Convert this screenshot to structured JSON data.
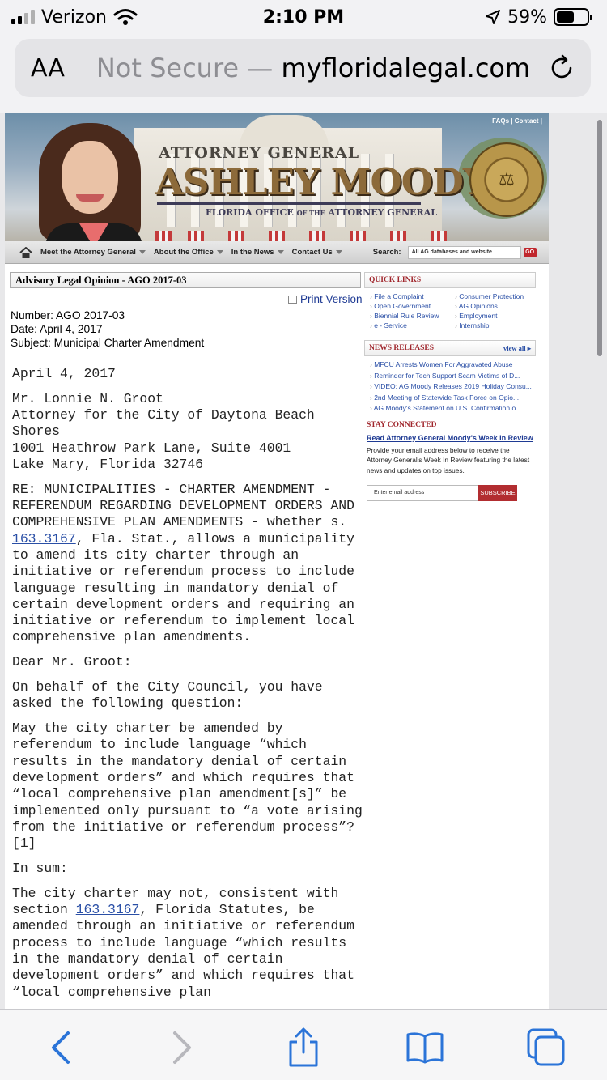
{
  "status_bar": {
    "carrier": "Verizon",
    "time": "2:10 PM",
    "battery": "59%",
    "battery_level": 0.59,
    "icons": [
      "signal-icon",
      "wifi-icon",
      "location-icon",
      "battery-icon"
    ]
  },
  "browser": {
    "text_size_label": "AA",
    "security_label": "Not Secure —",
    "url": "myfloridalegal.com",
    "icons": [
      "reload-icon"
    ]
  },
  "site": {
    "top_links": "FAQs | Contact |",
    "banner_line1": "ATTORNEY GENERAL",
    "banner_name_first": "ASHLEY",
    "banner_name_last": "MOODY",
    "banner_line3_a": "FLORIDA OFFICE",
    "banner_line3_b": "OF THE",
    "banner_line3_c": "ATTORNEY GENERAL",
    "nav": [
      {
        "label": "Meet the Attorney General"
      },
      {
        "label": "About the Office"
      },
      {
        "label": "In the News"
      },
      {
        "label": "Contact Us"
      }
    ],
    "search_label": "Search:",
    "search_value": "All AG databases and website",
    "go_label": "GO"
  },
  "opinion": {
    "header": "Advisory Legal Opinion - AGO 2017-03",
    "print_label": "Print Version",
    "number": "Number: AGO 2017-03",
    "date": "Date: April 4, 2017",
    "subject": "Subject: Municipal Charter Amendment",
    "letter_date": "April 4, 2017",
    "addr1": "Mr. Lonnie N. Groot",
    "addr2": "Attorney for the City of Daytona Beach Shores",
    "addr3": "1001 Heathrow Park Lane, Suite 4001",
    "addr4": "Lake Mary, Florida 32746",
    "re_a": "RE: MUNICIPALITIES - CHARTER AMENDMENT - REFERENDUM REGARDING DEVELOPMENT ORDERS AND COMPREHENSIVE PLAN AMENDMENTS - whether s. ",
    "re_link": "163.3167",
    "re_b": ", Fla. Stat., allows a municipality to amend its city charter through an initiative or referendum process to include language resulting in mandatory denial of certain development orders and requiring an initiative or referendum to implement local comprehensive plan amendments.",
    "salutation": "Dear Mr. Groot:",
    "para1": "On behalf of the City Council, you have asked the following question:",
    "question": "May the city charter be amended by referendum to include language “which results in the mandatory denial of certain development orders” and which requires that “local comprehensive plan amendment[s]” be implemented only pursuant to “a vote arising from the initiative or referendum process”?[1]",
    "in_sum": "In sum:",
    "sum_a": "The city charter may not, consistent with section ",
    "sum_link": "163.3167",
    "sum_b": ", Florida Statutes, be amended through an initiative or referendum process to include language “which results in the mandatory denial of certain development orders” and which requires that “local comprehensive plan"
  },
  "sidebar": {
    "quick_links_title": "QUICK LINKS",
    "quick_links": [
      "File a Complaint",
      "Consumer Protection",
      "Open Government",
      "AG Opinions",
      "Biennial Rule Review",
      "Employment",
      "e - Service",
      "Internship"
    ],
    "news_title": "NEWS RELEASES",
    "view_all": "view all",
    "news": [
      "MFCU Arrests Women For Aggravated Abuse",
      "Reminder for Tech Support Scam Victims of D...",
      "VIDEO: AG Moody Releases 2019 Holiday Consu...",
      "2nd Meeting of Statewide Task Force on Opio...",
      "AG Moody's Statement on U.S. Confirmation o..."
    ],
    "stay_title": "STAY CONNECTED",
    "week_link": "Read Attorney General Moody's Week In Review",
    "stay_text": "Provide your email address below to receive the Attorney General's Week In Review featuring the latest news and updates on top issues.",
    "email_placeholder": "Enter email address",
    "subscribe_label": "SUBSCRIBE"
  },
  "toolbar": {
    "icons": [
      "back-icon",
      "forward-icon",
      "share-icon",
      "bookmarks-icon",
      "tabs-icon"
    ]
  }
}
